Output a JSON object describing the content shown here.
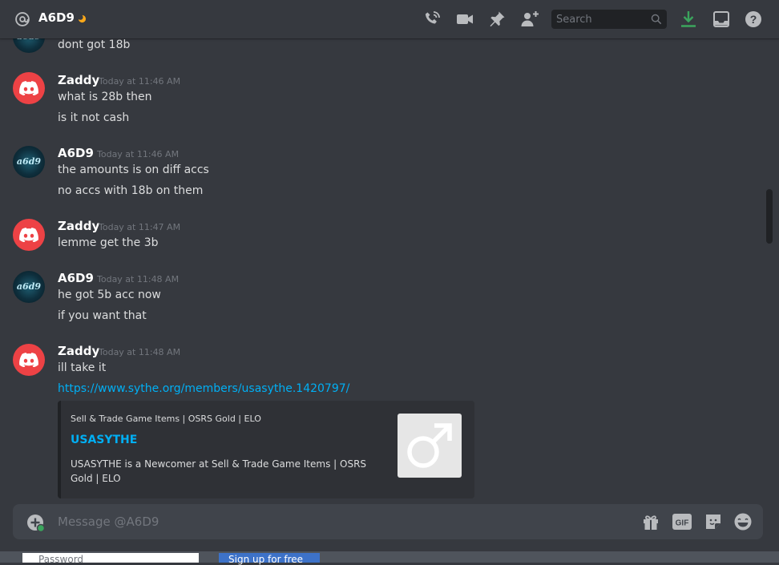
{
  "header": {
    "channel_name": "A6D9",
    "search_placeholder": "Search"
  },
  "messages": {
    "partial": {
      "text": "dont got 18b"
    },
    "groups": [
      {
        "author": "Zaddy",
        "timestamp": "Today at 11:46 AM",
        "lines": [
          "what is 28b then",
          "is it not cash"
        ]
      },
      {
        "author": "A6D9",
        "timestamp": "Today at 11:46 AM",
        "lines": [
          "the amounts is on diff accs",
          "no accs with 18b on them"
        ]
      },
      {
        "author": "Zaddy",
        "timestamp": "Today at 11:47 AM",
        "lines": [
          "lemme get the 3b"
        ]
      },
      {
        "author": "A6D9",
        "timestamp": "Today at 11:48 AM",
        "lines": [
          "he got 5b acc now",
          "if you want that"
        ]
      },
      {
        "author": "Zaddy",
        "timestamp": "Today at 11:48 AM",
        "lines": [
          "ill take it"
        ],
        "link": "https://www.sythe.org/members/usasythe.1420797/"
      }
    ],
    "avatar_text": "a6d9"
  },
  "embed": {
    "provider": "Sell & Trade Game Items | OSRS Gold | ELO",
    "title": "USASYTHE",
    "description": "USASYTHE is a Newcomer at Sell & Trade Game Items | OSRS Gold | ELO"
  },
  "composer": {
    "placeholder": "Message @A6D9",
    "gif_label": "GIF"
  },
  "background": {
    "password_label": "Password",
    "signup_label": "Sign up for free"
  },
  "colors": {
    "background": "#36393f",
    "link": "#00aff4",
    "discord_red": "#ed4245",
    "download_green": "#3ba55d",
    "status_idle": "#faa81a"
  },
  "icons": [
    "at-icon",
    "idle-moon-icon",
    "voice-call-icon",
    "video-call-icon",
    "pin-icon",
    "add-friend-icon",
    "search-icon",
    "download-icon",
    "inbox-icon",
    "help-icon",
    "discord-logo-icon",
    "male-symbol-icon",
    "add-attachment-icon",
    "gift-icon",
    "gif-icon",
    "sticker-icon",
    "emoji-icon"
  ]
}
